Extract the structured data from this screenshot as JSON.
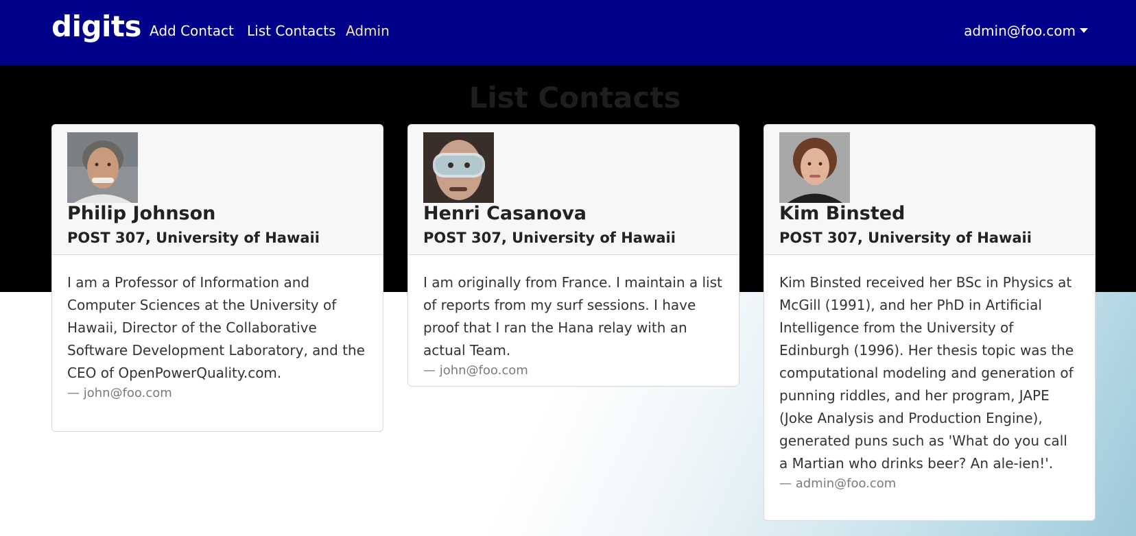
{
  "navbar": {
    "brand": "digits",
    "links": [
      "Add Contact",
      "List Contacts",
      "Admin"
    ],
    "user": "admin@foo.com",
    "colors": {
      "background": "#00008b",
      "admin_link": "#f2e6a8"
    }
  },
  "page": {
    "title": "List Contacts"
  },
  "contacts": [
    {
      "name": "Philip Johnson",
      "address": "POST 307, University of Hawaii",
      "description": "I am a Professor of Information and Computer Sciences at the University of Hawaii, Director of the Collaborative Software Development Laboratory, and the CEO of OpenPowerQuality.com.",
      "owner": "— john@foo.com"
    },
    {
      "name": "Henri Casanova",
      "address": "POST 307, University of Hawaii",
      "description": "I am originally from France. I maintain a list of reports from my surf sessions. I have proof that I ran the Hana relay with an actual Team.",
      "owner": "— john@foo.com"
    },
    {
      "name": "Kim Binsted",
      "address": "POST 307, University of Hawaii",
      "description": "Kim Binsted received her BSc in Physics at McGill (1991), and her PhD in Artificial Intelligence from the University of Edinburgh (1996). Her thesis topic was the computational modeling and generation of punning riddles, and her program, JAPE (Joke Analysis and Production Engine), generated puns such as 'What do you call a Martian who drinks beer? An ale-ien!'.",
      "owner": "— admin@foo.com"
    }
  ]
}
